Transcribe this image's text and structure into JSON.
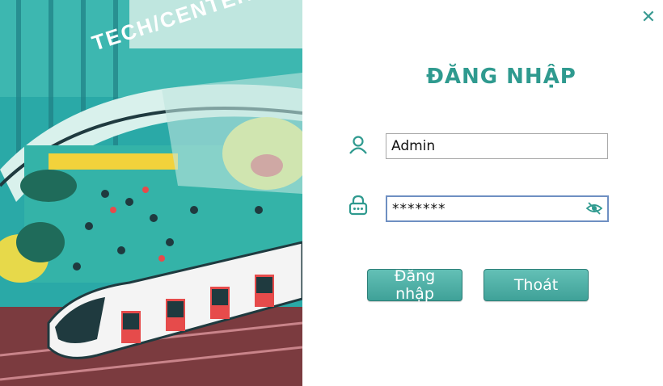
{
  "window": {
    "close_glyph": "✕"
  },
  "illustration": {
    "sign_line1": "TECH",
    "sign_line2": "CENTER",
    "colors": {
      "teal": "#2aa9a7",
      "dark": "#1f3a3f",
      "yellow": "#f2d23b",
      "red": "#e64b4b"
    }
  },
  "login": {
    "title": "ĐĂNG NHẬP",
    "username_icon": "user-icon",
    "username_value": "Admin",
    "password_icon": "lock-icon",
    "password_value": "*******",
    "toggle_icon": "eye-slash-icon",
    "login_button": "Đăng nhập",
    "exit_button": "Thoát"
  },
  "colors": {
    "accent": "#2f9a8f",
    "button": "#4fb1a7",
    "focus_border": "#6e8fc2"
  }
}
